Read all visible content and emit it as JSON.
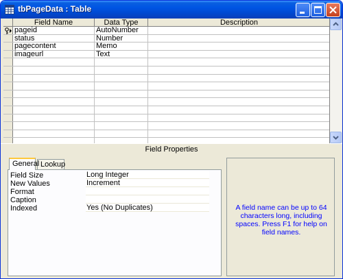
{
  "window": {
    "title": "tbPageData : Table",
    "icon": "table-icon"
  },
  "grid": {
    "columns": [
      "Field Name",
      "Data Type",
      "Description"
    ],
    "rows": [
      {
        "field": "pageid",
        "type": "AutoNumber",
        "description": "",
        "primary_key": true
      },
      {
        "field": "status",
        "type": "Number",
        "description": "",
        "primary_key": false
      },
      {
        "field": "pagecontent",
        "type": "Memo",
        "description": "",
        "primary_key": false
      },
      {
        "field": "imageurl",
        "type": "Text",
        "description": "",
        "primary_key": false
      }
    ]
  },
  "field_properties": {
    "title": "Field Properties",
    "tabs": [
      "General",
      "Lookup"
    ],
    "active_tab": "General",
    "properties": [
      {
        "label": "Field Size",
        "value": "Long Integer"
      },
      {
        "label": "New Values",
        "value": "Increment"
      },
      {
        "label": "Format",
        "value": ""
      },
      {
        "label": "Caption",
        "value": ""
      },
      {
        "label": "Indexed",
        "value": "Yes (No Duplicates)"
      }
    ],
    "help_text": "A field name can be up to 64 characters long, including spaces. Press F1 for help on field names."
  },
  "colors": {
    "titlebar": "#0054e3",
    "help_text": "#0000ff",
    "active_tab_highlight": "#ffc83c"
  }
}
